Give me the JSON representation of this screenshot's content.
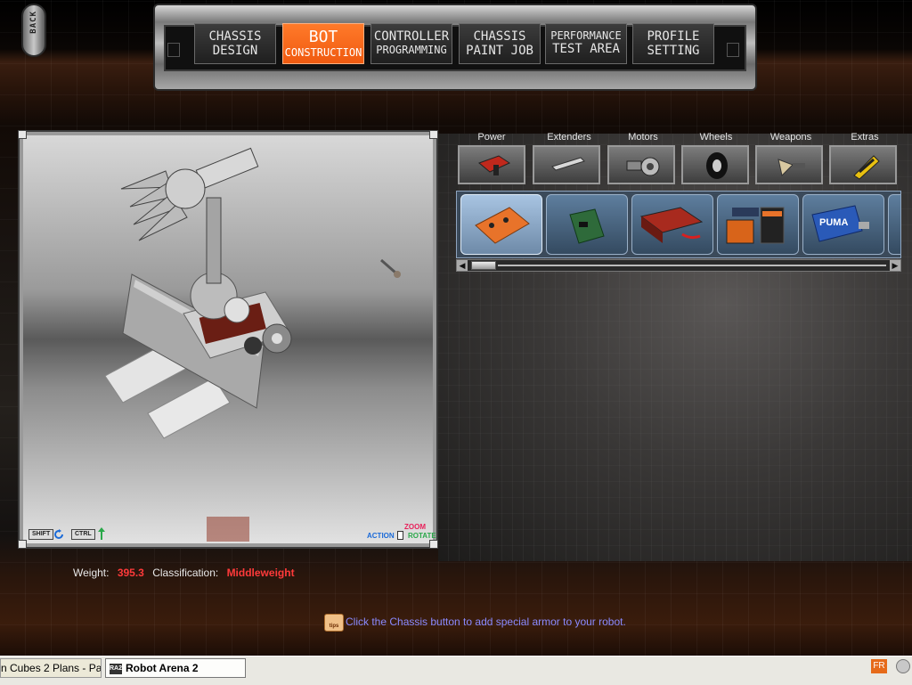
{
  "back_button": {
    "label": "BACK"
  },
  "nav": {
    "tabs": [
      {
        "line1": "CHASSIS",
        "line2": "DESIGN"
      },
      {
        "line1": "BOT",
        "line2": "CONSTRUCTION",
        "active": true
      },
      {
        "line1": "CONTROLLER",
        "line2": "PROGRAMMING"
      },
      {
        "line1": "CHASSIS",
        "line2": "PAINT JOB"
      },
      {
        "line1": "PERFORMANCE",
        "line2": "TEST AREA"
      },
      {
        "line1": "PROFILE",
        "line2": "SETTING"
      }
    ]
  },
  "viewport": {
    "controls": {
      "shift_key": "SHIFT",
      "ctrl_key": "CTRL",
      "action_label": "ACTION",
      "zoom_label": "ZOOM",
      "rotate_label": "ROTATE"
    }
  },
  "categories": [
    {
      "label": "Power",
      "icon": "battery-icon"
    },
    {
      "label": "Extenders",
      "icon": "extender-bar-icon"
    },
    {
      "label": "Motors",
      "icon": "motor-icon"
    },
    {
      "label": "Wheels",
      "icon": "wheel-icon"
    },
    {
      "label": "Weapons",
      "icon": "weapon-icon"
    },
    {
      "label": "Extras",
      "icon": "extras-icon"
    }
  ],
  "parts": [
    {
      "name": "orange-battery-pack",
      "selected": true
    },
    {
      "name": "green-circuit-board"
    },
    {
      "name": "red-battery-with-wire"
    },
    {
      "name": "twin-batteries"
    },
    {
      "name": "puma-battery",
      "text": "PUMA"
    }
  ],
  "stats": {
    "weight_label": "Weight:",
    "weight_value": "395.3",
    "class_label": "Classification:",
    "class_value": "Middleweight"
  },
  "tip": {
    "icon_text": "tips",
    "text": "Click the Chassis button to add special armor to your robot."
  },
  "taskbar": {
    "items": [
      {
        "label": "n Cubes 2 Plans - Pa..."
      },
      {
        "icon_text": "RA2",
        "label": "Robot Arena 2"
      }
    ],
    "language": "FR"
  },
  "colors": {
    "accent_orange": "#f05a10",
    "stat_red": "#ff3a3a",
    "tip_blue": "#8a8aff"
  }
}
